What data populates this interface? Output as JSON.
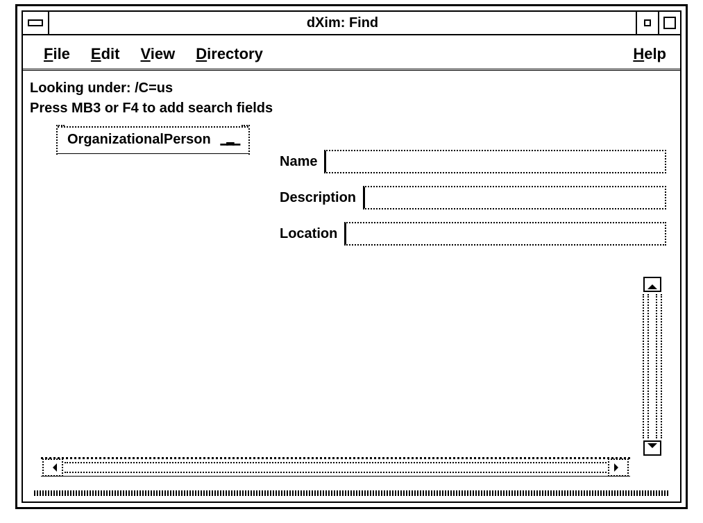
{
  "titlebar": {
    "title": "dXim: Find"
  },
  "menu": {
    "file": {
      "pre": "",
      "u": "F",
      "post": "ile"
    },
    "edit": {
      "pre": "",
      "u": "E",
      "post": "dit"
    },
    "view": {
      "pre": "",
      "u": "V",
      "post": "iew"
    },
    "dir": {
      "pre": "",
      "u": "D",
      "post": "irectory"
    },
    "help": {
      "pre": "",
      "u": "H",
      "post": "elp"
    }
  },
  "info": {
    "looking": "Looking under: /C=us",
    "hint": "Press MB3 or F4 to add search fields"
  },
  "object_class": {
    "value": "OrganizationalPerson"
  },
  "fields": {
    "name": {
      "label": "Name",
      "value": ""
    },
    "description": {
      "label": "Description",
      "value": ""
    },
    "location": {
      "label": "Location",
      "value": ""
    }
  }
}
